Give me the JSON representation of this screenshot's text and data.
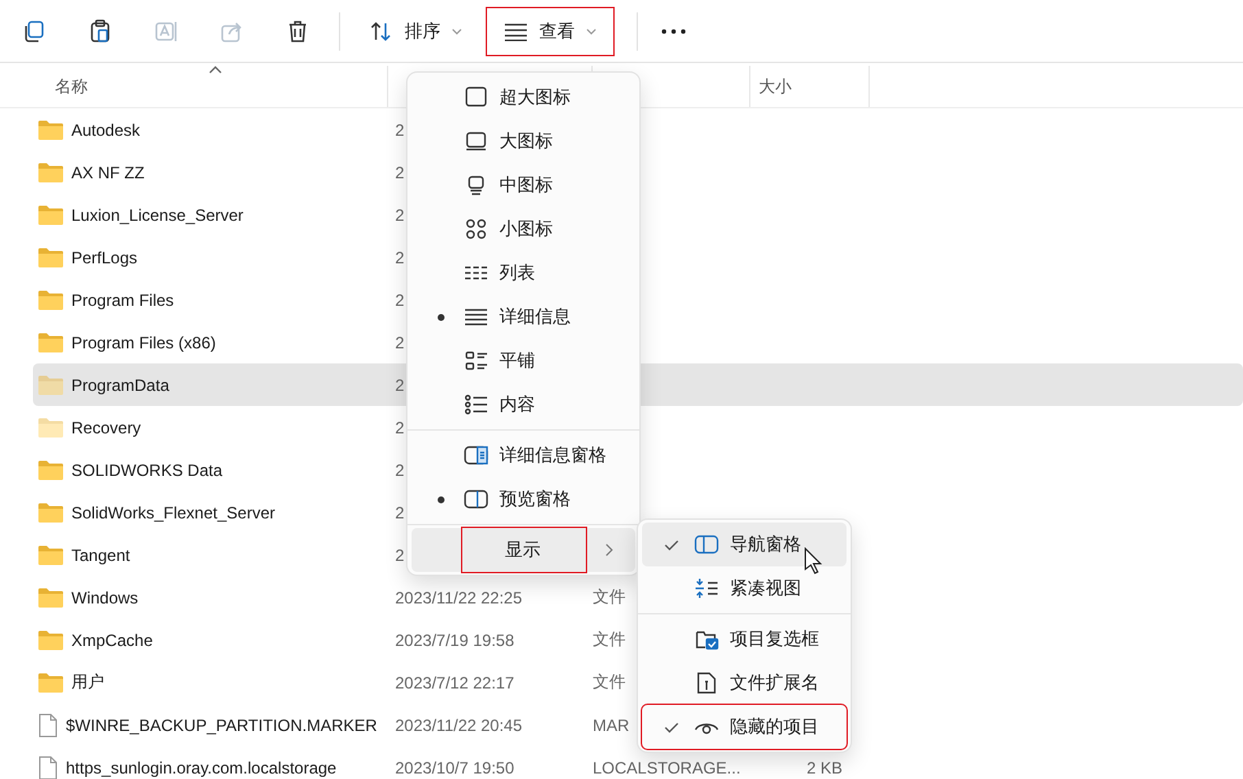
{
  "toolbar": {
    "actions": [
      {
        "disabled": false
      },
      {
        "disabled": false
      },
      {
        "disabled": true
      },
      {
        "disabled": true
      },
      {
        "disabled": false
      }
    ],
    "sort_button": {
      "label": "排序"
    },
    "view_button": {
      "label": "查看",
      "highlighted": true
    }
  },
  "table": {
    "columns": [
      {
        "label": "名称",
        "sorted": true
      },
      {
        "label": "大小"
      }
    ],
    "rows": [
      {
        "name": "Autodesk",
        "kind": "folder",
        "hidden": false,
        "selected": false,
        "date": "2"
      },
      {
        "name": "AX NF ZZ",
        "kind": "folder",
        "hidden": false,
        "selected": false,
        "date": "2"
      },
      {
        "name": "Luxion_License_Server",
        "kind": "folder",
        "hidden": false,
        "selected": false,
        "date": "2"
      },
      {
        "name": "PerfLogs",
        "kind": "folder",
        "hidden": false,
        "selected": false,
        "date": "2"
      },
      {
        "name": "Program Files",
        "kind": "folder",
        "hidden": false,
        "selected": false,
        "date": "2"
      },
      {
        "name": "Program Files (x86)",
        "kind": "folder",
        "hidden": false,
        "selected": false,
        "date": "2"
      },
      {
        "name": "ProgramData",
        "kind": "folder",
        "hidden": true,
        "selected": true,
        "date": "2"
      },
      {
        "name": "Recovery",
        "kind": "folder",
        "hidden": true,
        "selected": false,
        "date": "2"
      },
      {
        "name": "SOLIDWORKS Data",
        "kind": "folder",
        "hidden": false,
        "selected": false,
        "date": "2"
      },
      {
        "name": "SolidWorks_Flexnet_Server",
        "kind": "folder",
        "hidden": false,
        "selected": false,
        "date": "2"
      },
      {
        "name": "Tangent",
        "kind": "folder",
        "hidden": false,
        "selected": false,
        "date": "2"
      },
      {
        "name": "Windows",
        "kind": "folder",
        "hidden": false,
        "selected": false,
        "date": "2023/11/22 22:25",
        "type": "文件"
      },
      {
        "name": "XmpCache",
        "kind": "folder",
        "hidden": false,
        "selected": false,
        "date": "2023/7/19 19:58",
        "type": "文件"
      },
      {
        "name": "用户",
        "kind": "folder",
        "hidden": false,
        "selected": false,
        "date": "2023/7/12 22:17",
        "type": "文件"
      },
      {
        "name": "$WINRE_BACKUP_PARTITION.MARKER",
        "kind": "file",
        "hidden": false,
        "selected": false,
        "date": "2023/11/22 20:45",
        "type": "MAR"
      },
      {
        "name": "https_sunlogin.oray.com.localstorage",
        "kind": "file",
        "hidden": false,
        "selected": false,
        "date": "2023/10/7 19:50",
        "type": "LOCALSTORAGE...",
        "size": "2 KB"
      }
    ]
  },
  "view_menu": {
    "groups": [
      [
        {
          "label": "超大图标",
          "selected": false
        },
        {
          "label": "大图标",
          "selected": false
        },
        {
          "label": "中图标",
          "selected": false
        },
        {
          "label": "小图标",
          "selected": false
        },
        {
          "label": "列表",
          "selected": false
        },
        {
          "label": "详细信息",
          "selected": true
        },
        {
          "label": "平铺",
          "selected": false
        },
        {
          "label": "内容",
          "selected": false
        }
      ],
      [
        {
          "label": "详细信息窗格",
          "selected": false
        },
        {
          "label": "预览窗格",
          "selected": true
        }
      ],
      [
        {
          "label": "显示",
          "selected": false,
          "hovered": true,
          "highlighted": true,
          "submenu": true
        }
      ]
    ]
  },
  "show_menu": {
    "groups": [
      [
        {
          "label": "导航窗格",
          "checked": true,
          "hovered": true,
          "highlighted": false
        },
        {
          "label": "紧凑视图",
          "checked": false,
          "hovered": false,
          "highlighted": false
        }
      ],
      [
        {
          "label": "项目复选框",
          "checked": false,
          "hovered": false,
          "highlighted": false
        },
        {
          "label": "文件扩展名",
          "checked": false,
          "hovered": false,
          "highlighted": false
        },
        {
          "label": "隐藏的项目",
          "checked": true,
          "hovered": false,
          "highlighted": true
        }
      ]
    ]
  }
}
